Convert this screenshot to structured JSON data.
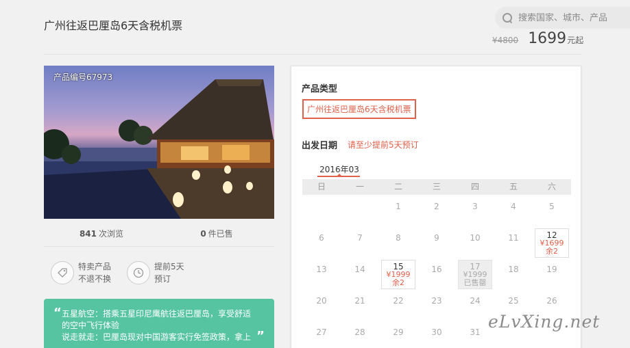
{
  "search": {
    "placeholder": "搜索国家、城市、产品"
  },
  "product": {
    "title": "广州往返巴厘岛6天含税机票",
    "original_price": "¥4800",
    "price": "1699",
    "price_unit": "元起",
    "code_label": "产品编号67973"
  },
  "stats": {
    "views_count": "841",
    "views_label": "次浏览",
    "sold_count": "0",
    "sold_label": "件已售"
  },
  "features": [
    {
      "line1": "特卖产品",
      "line2": "不退不换",
      "icon": "tag-icon"
    },
    {
      "line1": "提前5天",
      "line2": "预订",
      "icon": "clock-icon"
    }
  ],
  "quote": {
    "line1": "五星航空：搭乘五星印尼鹰航往返巴厘岛，享受舒适",
    "line2": "的空中飞行体验",
    "line3": "说走就走：巴厘岛现对中国游客实行免签政策，拿上"
  },
  "booking": {
    "type_heading": "产品类型",
    "type_option": "广州往返巴厘岛6天含税机票",
    "date_heading": "出发日期",
    "date_hint": "请至少提前5天预订",
    "month": "2016年03",
    "weekdays": [
      "日",
      "一",
      "二",
      "三",
      "四",
      "五",
      "六"
    ],
    "calendar": [
      [
        {
          "d": ""
        },
        {
          "d": ""
        },
        {
          "d": "1"
        },
        {
          "d": "2"
        },
        {
          "d": "3"
        },
        {
          "d": "4"
        },
        {
          "d": "5"
        }
      ],
      [
        {
          "d": "6"
        },
        {
          "d": "7"
        },
        {
          "d": "8"
        },
        {
          "d": "9"
        },
        {
          "d": "10"
        },
        {
          "d": "11"
        },
        {
          "d": "12",
          "price": "¥1699",
          "stock": "余2",
          "status": "available"
        }
      ],
      [
        {
          "d": "13"
        },
        {
          "d": "14"
        },
        {
          "d": "15",
          "price": "¥1999",
          "stock": "余2",
          "status": "available"
        },
        {
          "d": "16"
        },
        {
          "d": "17",
          "price": "¥1999",
          "stock": "已售罄",
          "status": "soldout"
        },
        {
          "d": "18"
        },
        {
          "d": "19"
        }
      ],
      [
        {
          "d": "20"
        },
        {
          "d": "21"
        },
        {
          "d": "22"
        },
        {
          "d": "23"
        },
        {
          "d": "24"
        },
        {
          "d": "25"
        },
        {
          "d": "26"
        }
      ],
      [
        {
          "d": "27"
        },
        {
          "d": "28"
        },
        {
          "d": "29"
        },
        {
          "d": "30"
        },
        {
          "d": "31"
        },
        {
          "d": ""
        },
        {
          "d": ""
        }
      ]
    ]
  },
  "watermark": "eLvXing.net"
}
